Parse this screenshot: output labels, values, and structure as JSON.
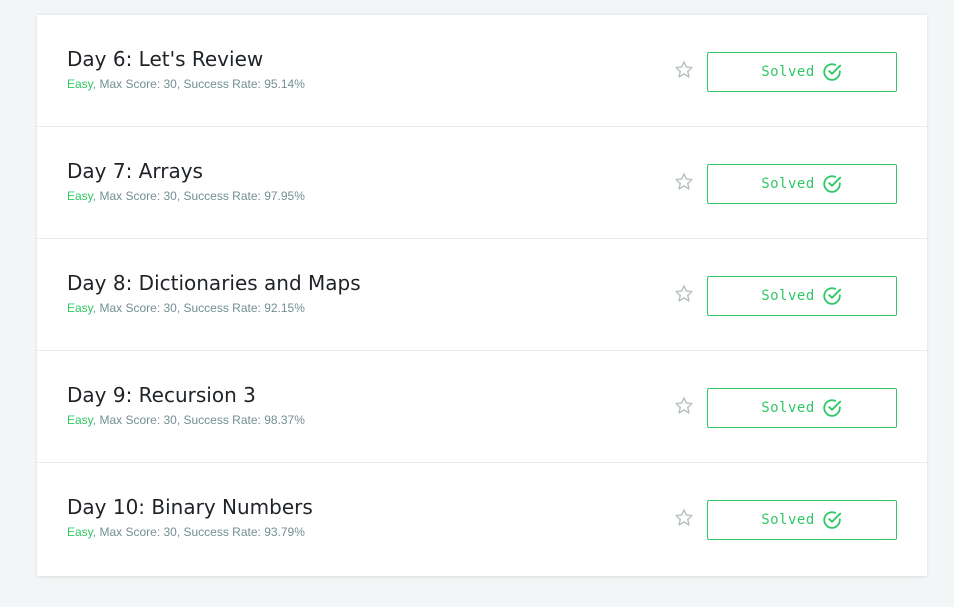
{
  "challenges": [
    {
      "title": "Day 6: Let's Review",
      "difficulty": "Easy",
      "details": ", Max Score: 30, Success Rate: 95.14%",
      "status_label": "Solved"
    },
    {
      "title": "Day 7: Arrays",
      "difficulty": "Easy",
      "details": ", Max Score: 30, Success Rate: 97.95%",
      "status_label": "Solved"
    },
    {
      "title": "Day 8: Dictionaries and Maps",
      "difficulty": "Easy",
      "details": ", Max Score: 30, Success Rate: 92.15%",
      "status_label": "Solved"
    },
    {
      "title": "Day 9: Recursion 3",
      "difficulty": "Easy",
      "details": ", Max Score: 30, Success Rate: 98.37%",
      "status_label": "Solved"
    },
    {
      "title": "Day 10: Binary Numbers",
      "difficulty": "Easy",
      "details": ", Max Score: 30, Success Rate: 93.79%",
      "status_label": "Solved"
    }
  ],
  "icons": {
    "bookmark": "star-outline-icon",
    "solved": "check-circle-icon"
  },
  "colors": {
    "accent_green": "#2ec866",
    "meta_gray": "#738f93",
    "star_gray": "#b7c2c4"
  }
}
